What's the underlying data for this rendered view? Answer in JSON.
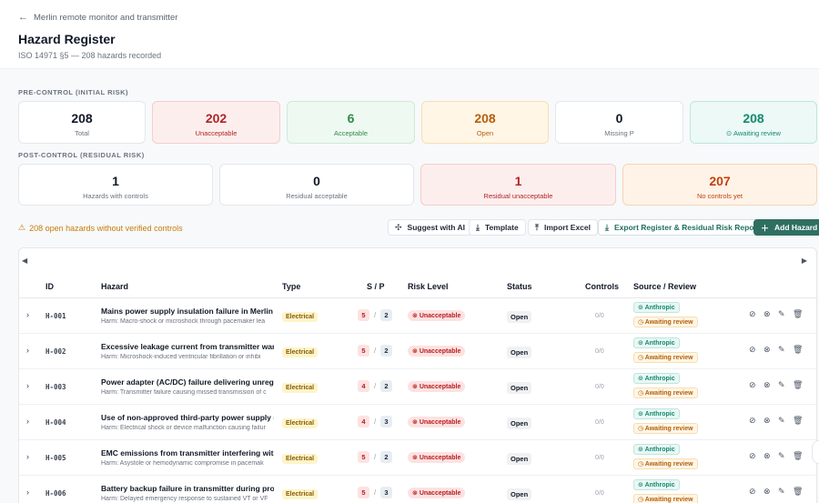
{
  "header": {
    "back_label": "Merlin remote monitor and transmitter",
    "title": "Hazard Register",
    "subtitle": "ISO 14971 §5 — 208 hazards recorded"
  },
  "pre_control": {
    "label": "PRE-CONTROL (INITIAL RISK)",
    "cards": [
      {
        "value": "208",
        "label": "Total"
      },
      {
        "value": "202",
        "label": "Unacceptable"
      },
      {
        "value": "6",
        "label": "Acceptable"
      },
      {
        "value": "208",
        "label": "Open"
      },
      {
        "value": "0",
        "label": "Missing P"
      },
      {
        "value": "208",
        "label": "Awaiting review"
      }
    ]
  },
  "post_control": {
    "label": "POST-CONTROL (RESIDUAL RISK)",
    "cards": [
      {
        "value": "1",
        "label": "Hazards with controls"
      },
      {
        "value": "0",
        "label": "Residual acceptable"
      },
      {
        "value": "1",
        "label": "Residual unacceptable"
      },
      {
        "value": "207",
        "label": "No controls yet"
      }
    ]
  },
  "warning": "208 open hazards without verified controls",
  "toolbar": {
    "suggest": "Suggest with AI",
    "template": "Template",
    "import": "Import Excel",
    "export": "Export Register & Residual Risk Report",
    "add": "Add Hazard"
  },
  "columns": {
    "id": "ID",
    "hazard": "Hazard",
    "type": "Type",
    "sp": "S / P",
    "risk": "Risk Level",
    "status": "Status",
    "controls": "Controls",
    "source": "Source / Review"
  },
  "rows": [
    {
      "id": "H-001",
      "title": "Mains power supply insulation failure in Merlin h",
      "harm": "Harm: Macro-shock or microshock through pacemaker lea",
      "type": "Electrical",
      "s": "5",
      "p": "2",
      "risk": "Unacceptable",
      "status": "Open",
      "controls": "0/0",
      "source": "Anthropic",
      "review": "Awaiting review"
    },
    {
      "id": "H-002",
      "title": "Excessive leakage current from transmitter wand",
      "harm": "Harm: Microshock-induced ventricular fibrillation or inhibi",
      "type": "Electrical",
      "s": "5",
      "p": "2",
      "risk": "Unacceptable",
      "status": "Open",
      "controls": "0/0",
      "source": "Anthropic",
      "review": "Awaiting review"
    },
    {
      "id": "H-003",
      "title": "Power adapter (AC/DC) failure delivering unregu",
      "harm": "Harm: Transmitter failure causing missed transmission of c",
      "type": "Electrical",
      "s": "4",
      "p": "2",
      "risk": "Unacceptable",
      "status": "Open",
      "controls": "0/0",
      "source": "Anthropic",
      "review": "Awaiting review"
    },
    {
      "id": "H-004",
      "title": "Use of non-approved third-party power supply c",
      "harm": "Harm: Electrical shock or device malfunction causing failur",
      "type": "Electrical",
      "s": "4",
      "p": "3",
      "risk": "Unacceptable",
      "status": "Open",
      "controls": "0/0",
      "source": "Anthropic",
      "review": "Awaiting review"
    },
    {
      "id": "H-005",
      "title": "EMC emissions from transmitter interfering with",
      "harm": "Harm: Asystole or hemodynamic compromise in pacemak",
      "type": "Electrical",
      "s": "5",
      "p": "2",
      "risk": "Unacceptable",
      "status": "Open",
      "controls": "0/0",
      "source": "Anthropic",
      "review": "Awaiting review"
    },
    {
      "id": "H-006",
      "title": "Battery backup failure in transmitter during prol",
      "harm": "Harm: Delayed emergency response to sustained VT or VF",
      "type": "Electrical",
      "s": "5",
      "p": "3",
      "risk": "Unacceptable",
      "status": "Open",
      "controls": "0/0",
      "source": "Anthropic",
      "review": "Awaiting review"
    }
  ]
}
